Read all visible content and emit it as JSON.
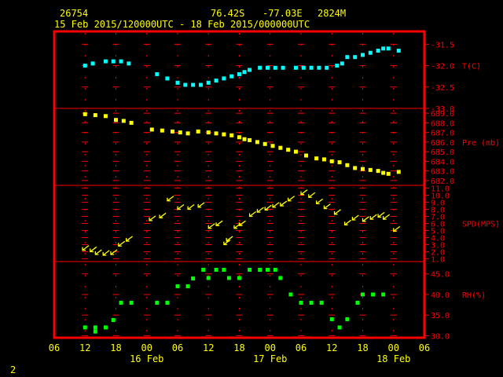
{
  "header": {
    "station": "26754",
    "lat": "76.42S",
    "lon": "-77.03E",
    "elev": "2824M",
    "range": "15 Feb 2015/120000UTC - 18 Feb 2015/000000UTC"
  },
  "footer": {
    "page": "2"
  },
  "chart_data": {
    "type": "scatter",
    "x_tick_labels": [
      "06",
      "12",
      "18",
      "00",
      "06",
      "12",
      "18",
      "00",
      "06",
      "12",
      "18",
      "00",
      "06"
    ],
    "date_labels": [
      {
        "at_hour": 24,
        "label": "16 Feb"
      },
      {
        "at_hour": 48,
        "label": "17 Feb"
      },
      {
        "at_hour": 72,
        "label": "18 Feb"
      }
    ],
    "x_unit_note": "hours from 15 Feb 2015 00 UTC",
    "xlim": [
      6,
      78
    ],
    "colors": {
      "frame": "#ff0000",
      "grid": "#ff0000",
      "text": "#ffff00",
      "temp": "#00ffff",
      "pres": "#ffff00",
      "wind": "#ffff00",
      "rh": "#00ff00"
    },
    "panels": [
      {
        "key": "temp",
        "label": "T(C)",
        "ylim": [
          -33.0,
          -31.2
        ],
        "ticks": [
          "-31.5",
          "-32.0",
          "-32.5",
          "-33.0"
        ],
        "tick_values": [
          -31.5,
          -32.0,
          -32.5,
          -33.0
        ],
        "series": [
          [
            12,
            -32.0
          ],
          [
            13.5,
            -31.95
          ],
          [
            16,
            -31.9
          ],
          [
            17.5,
            -31.9
          ],
          [
            19,
            -31.9
          ],
          [
            20.5,
            -31.95
          ],
          [
            26,
            -32.2
          ],
          [
            28,
            -32.3
          ],
          [
            30,
            -32.4
          ],
          [
            31.5,
            -32.45
          ],
          [
            33,
            -32.45
          ],
          [
            34.5,
            -32.45
          ],
          [
            36,
            -32.4
          ],
          [
            37.5,
            -32.35
          ],
          [
            39,
            -32.3
          ],
          [
            40.5,
            -32.25
          ],
          [
            42,
            -32.2
          ],
          [
            43,
            -32.15
          ],
          [
            44,
            -32.1
          ],
          [
            46,
            -32.05
          ],
          [
            47.5,
            -32.05
          ],
          [
            49,
            -32.05
          ],
          [
            50.5,
            -32.05
          ],
          [
            53,
            -32.05
          ],
          [
            54.5,
            -32.05
          ],
          [
            56,
            -32.05
          ],
          [
            57.5,
            -32.05
          ],
          [
            59,
            -32.05
          ],
          [
            61,
            -32.0
          ],
          [
            62,
            -31.95
          ],
          [
            63,
            -31.8
          ],
          [
            64.5,
            -31.8
          ],
          [
            66,
            -31.75
          ],
          [
            67.5,
            -31.7
          ],
          [
            69,
            -31.65
          ],
          [
            70,
            -31.6
          ],
          [
            71,
            -31.6
          ],
          [
            73,
            -31.65
          ]
        ]
      },
      {
        "key": "pres",
        "label": "Pre (mb)",
        "ylim": [
          681.5,
          689.5
        ],
        "ticks": [
          "689.0",
          "688.0",
          "687.0",
          "686.0",
          "685.0",
          "684.0",
          "683.0",
          "682.0"
        ],
        "tick_values": [
          689,
          688,
          687,
          686,
          685,
          684,
          683,
          682
        ],
        "series": [
          [
            12,
            688.9
          ],
          [
            14,
            688.8
          ],
          [
            16,
            688.7
          ],
          [
            18,
            688.3
          ],
          [
            19.5,
            688.2
          ],
          [
            21,
            688.0
          ],
          [
            25,
            687.3
          ],
          [
            27,
            687.2
          ],
          [
            29,
            687.1
          ],
          [
            30.5,
            687.0
          ],
          [
            32,
            686.9
          ],
          [
            34,
            687.1
          ],
          [
            36,
            687.0
          ],
          [
            37.5,
            686.9
          ],
          [
            39,
            686.8
          ],
          [
            40.5,
            686.7
          ],
          [
            42,
            686.5
          ],
          [
            43,
            686.3
          ],
          [
            44,
            686.2
          ],
          [
            45.5,
            686.0
          ],
          [
            47,
            685.8
          ],
          [
            48.5,
            685.6
          ],
          [
            50,
            685.4
          ],
          [
            51.5,
            685.2
          ],
          [
            53,
            685.0
          ],
          [
            55,
            684.6
          ],
          [
            57,
            684.3
          ],
          [
            58.5,
            684.2
          ],
          [
            60,
            684.0
          ],
          [
            61.5,
            683.9
          ],
          [
            63,
            683.6
          ],
          [
            64.5,
            683.3
          ],
          [
            66,
            683.2
          ],
          [
            67.5,
            683.1
          ],
          [
            69,
            683.0
          ],
          [
            70,
            682.8
          ],
          [
            71,
            682.7
          ],
          [
            73,
            682.9
          ]
        ]
      },
      {
        "key": "wind",
        "label": "SPD(MPS)",
        "ylim": [
          0.6,
          11.4
        ],
        "ticks": [
          "11.0",
          "10.0",
          "9.0",
          "8.0",
          "7.0",
          "6.0",
          "5.0",
          "4.0",
          "3.0",
          "2.0",
          "1.0"
        ],
        "tick_values": [
          11,
          10,
          9,
          8,
          7,
          6,
          5,
          4,
          3,
          2,
          1
        ],
        "series": [
          [
            11.5,
            2.2
          ],
          [
            13,
            2.0
          ],
          [
            14,
            1.6
          ],
          [
            15.5,
            1.5
          ],
          [
            17,
            1.6
          ],
          [
            18.5,
            2.8
          ],
          [
            20,
            3.5
          ],
          [
            24.5,
            6.4
          ],
          [
            26.5,
            6.8
          ],
          [
            28,
            9.2
          ],
          [
            30,
            8.0
          ],
          [
            32,
            8.0
          ],
          [
            34,
            8.3
          ],
          [
            36,
            5.3
          ],
          [
            37.5,
            5.7
          ],
          [
            39,
            3.0
          ],
          [
            39.5,
            3.5
          ],
          [
            41,
            5.3
          ],
          [
            42,
            5.7
          ],
          [
            44,
            7.0
          ],
          [
            45.5,
            7.6
          ],
          [
            47,
            7.9
          ],
          [
            48.5,
            8.3
          ],
          [
            50,
            8.5
          ],
          [
            51.5,
            9.2
          ],
          [
            54,
            10.1
          ],
          [
            55.5,
            9.7
          ],
          [
            57,
            8.8
          ],
          [
            58.5,
            8.1
          ],
          [
            60.5,
            7.3
          ],
          [
            62.5,
            5.8
          ],
          [
            64,
            6.5
          ],
          [
            66,
            6.3
          ],
          [
            67.5,
            6.6
          ],
          [
            69,
            6.9
          ],
          [
            70,
            6.6
          ],
          [
            72,
            4.9
          ]
        ]
      },
      {
        "key": "rh",
        "label": "RH(%)",
        "ylim": [
          29.5,
          48.0
        ],
        "ticks": [
          "45.0",
          "40.0",
          "35.0",
          "30.0"
        ],
        "tick_values": [
          45,
          40,
          35,
          30
        ],
        "series": [
          [
            12,
            32.0
          ],
          [
            14,
            32.0
          ],
          [
            16,
            32.0
          ],
          [
            17.5,
            33.8
          ],
          [
            19,
            38.0
          ],
          [
            21,
            38.0
          ],
          [
            26,
            38.0
          ],
          [
            28,
            38.0
          ],
          [
            30,
            42.0
          ],
          [
            32,
            42.0
          ],
          [
            33,
            43.9
          ],
          [
            35,
            46.0
          ],
          [
            36,
            44.0
          ],
          [
            37.5,
            46.0
          ],
          [
            39,
            46.0
          ],
          [
            40,
            44.0
          ],
          [
            42,
            44.0
          ],
          [
            44,
            46.0
          ],
          [
            46,
            46.0
          ],
          [
            47.5,
            46.0
          ],
          [
            49,
            46.0
          ],
          [
            50,
            44.0
          ],
          [
            52,
            40.0
          ],
          [
            54,
            38.0
          ],
          [
            56,
            38.0
          ],
          [
            58,
            38.0
          ],
          [
            60,
            34.0
          ],
          [
            61.5,
            32.0
          ],
          [
            63,
            34.0
          ],
          [
            65,
            38.0
          ],
          [
            66,
            40.0
          ],
          [
            68,
            40.0
          ],
          [
            70,
            40.0
          ],
          [
            14,
            31.0
          ]
        ]
      }
    ]
  }
}
